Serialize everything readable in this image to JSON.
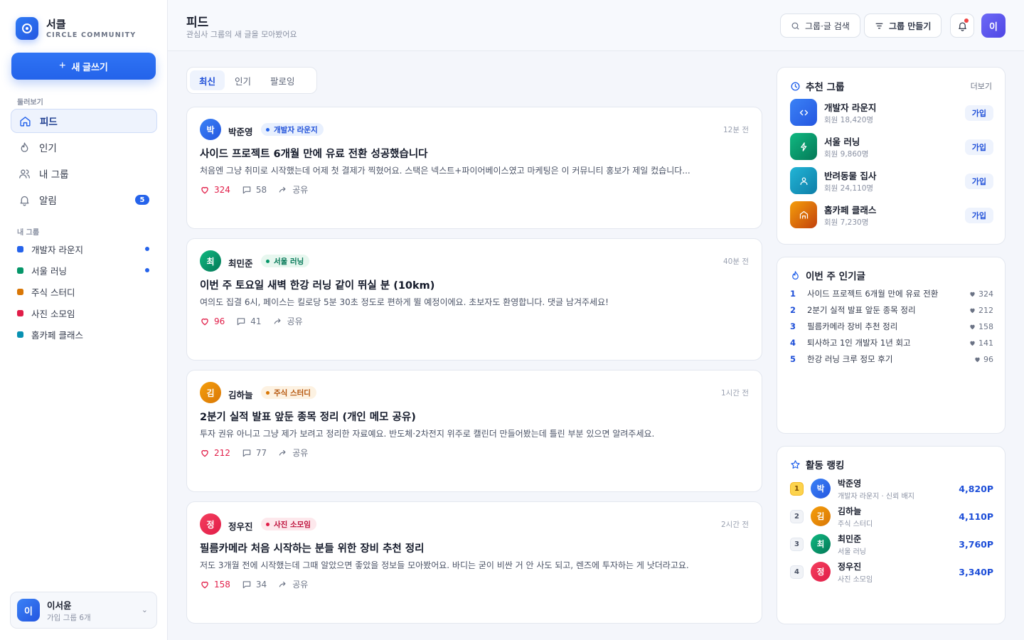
{
  "brand": {
    "name": "서클",
    "sub": "CIRCLE COMMUNITY"
  },
  "sidebar": {
    "new_post": "새 글쓰기",
    "browse_label": "둘러보기",
    "nav": [
      {
        "label": "피드"
      },
      {
        "label": "인기"
      },
      {
        "label": "내 그룹"
      },
      {
        "label": "알림",
        "badge": "5"
      }
    ],
    "groups_label": "내 그룹",
    "groups": [
      {
        "label": "개발자 라운지",
        "color": "#2563eb",
        "unread": true
      },
      {
        "label": "서울 러닝",
        "color": "#059669",
        "unread": true
      },
      {
        "label": "주식 스터디",
        "color": "#d97706",
        "unread": false
      },
      {
        "label": "사진 소모임",
        "color": "#e11d48",
        "unread": false
      },
      {
        "label": "홈카페 클래스",
        "color": "#0891b2",
        "unread": false
      }
    ],
    "me": {
      "avatar": "이",
      "name": "이서윤",
      "meta": "가입 그룹 6개"
    }
  },
  "header": {
    "title": "피드",
    "subtitle": "관심사 그룹의 새 글을 모아봤어요",
    "search": "그룹·글 검색",
    "create": "그룹 만들기",
    "avatar": "이"
  },
  "tabs": [
    "최신",
    "인기",
    "팔로잉"
  ],
  "posts": [
    {
      "avatar": "박",
      "author": "박준영",
      "group": "개발자 라운지",
      "time": "12분 전",
      "title": "사이드 프로젝트 6개월 만에 유료 전환 성공했습니다",
      "body": "처음엔 그냥 취미로 시작했는데 어제 첫 결제가 찍혔어요. 스택은 넥스트+파이어베이스였고 마케팅은 이 커뮤니티 홍보가 제일 컸습니다...",
      "likes": "324",
      "comments": "58",
      "share": "공유"
    },
    {
      "avatar": "최",
      "author": "최민준",
      "group": "서울 러닝",
      "time": "40분 전",
      "title": "이번 주 토요일 새벽 한강 러닝 같이 뛰실 분 (10km)",
      "body": "여의도 집결 6시, 페이스는 킬로당 5분 30초 정도로 편하게 뛸 예정이에요. 초보자도 환영합니다. 댓글 남겨주세요!",
      "likes": "96",
      "comments": "41",
      "share": "공유"
    },
    {
      "avatar": "김",
      "author": "김하늘",
      "group": "주식 스터디",
      "time": "1시간 전",
      "title": "2분기 실적 발표 앞둔 종목 정리 (개인 메모 공유)",
      "body": "투자 권유 아니고 그냥 제가 보려고 정리한 자료예요. 반도체·2차전지 위주로 캘린더 만들어봤는데 틀린 부분 있으면 알려주세요.",
      "likes": "212",
      "comments": "77",
      "share": "공유"
    },
    {
      "avatar": "정",
      "author": "정우진",
      "group": "사진 소모임",
      "time": "2시간 전",
      "title": "필름카메라 처음 시작하는 분들 위한 장비 추천 정리",
      "body": "저도 3개월 전에 시작했는데 그때 알았으면 좋았을 정보들 모아봤어요. 바디는 굳이 비싼 거 안 사도 되고, 렌즈에 투자하는 게 낫더라고요.",
      "likes": "158",
      "comments": "34",
      "share": "공유"
    }
  ],
  "recommended": {
    "title": "추천 그룹",
    "more": "더보기",
    "join": "가입",
    "items": [
      {
        "name": "개발자 라운지",
        "members": "회원 18,420명"
      },
      {
        "name": "서울 러닝",
        "members": "회원 9,860명"
      },
      {
        "name": "반려동물 집사",
        "members": "회원 24,110명"
      },
      {
        "name": "홈카페 클래스",
        "members": "회원 7,230명"
      }
    ]
  },
  "popular": {
    "title": "이번 주 인기글",
    "items": [
      {
        "rank": "1",
        "title": "사이드 프로젝트 6개월 만에 유료 전환",
        "likes": "324"
      },
      {
        "rank": "2",
        "title": "2분기 실적 발표 앞둔 종목 정리",
        "likes": "212"
      },
      {
        "rank": "3",
        "title": "필름카메라 장비 추천 정리",
        "likes": "158"
      },
      {
        "rank": "4",
        "title": "퇴사하고 1인 개발자 1년 회고",
        "likes": "141"
      },
      {
        "rank": "5",
        "title": "한강 러닝 크루 정모 후기",
        "likes": "96"
      }
    ]
  },
  "ranking": {
    "title": "활동 랭킹",
    "items": [
      {
        "rank": "1",
        "avatar": "박",
        "name": "박준영",
        "meta": "개발자 라운지 · 신뢰 배지",
        "points": "4,820P"
      },
      {
        "rank": "2",
        "avatar": "김",
        "name": "김하늘",
        "meta": "주식 스터디",
        "points": "4,110P"
      },
      {
        "rank": "3",
        "avatar": "최",
        "name": "최민준",
        "meta": "서울 러닝",
        "points": "3,760P"
      },
      {
        "rank": "4",
        "avatar": "정",
        "name": "정우진",
        "meta": "사진 소모임",
        "points": "3,340P"
      }
    ]
  }
}
